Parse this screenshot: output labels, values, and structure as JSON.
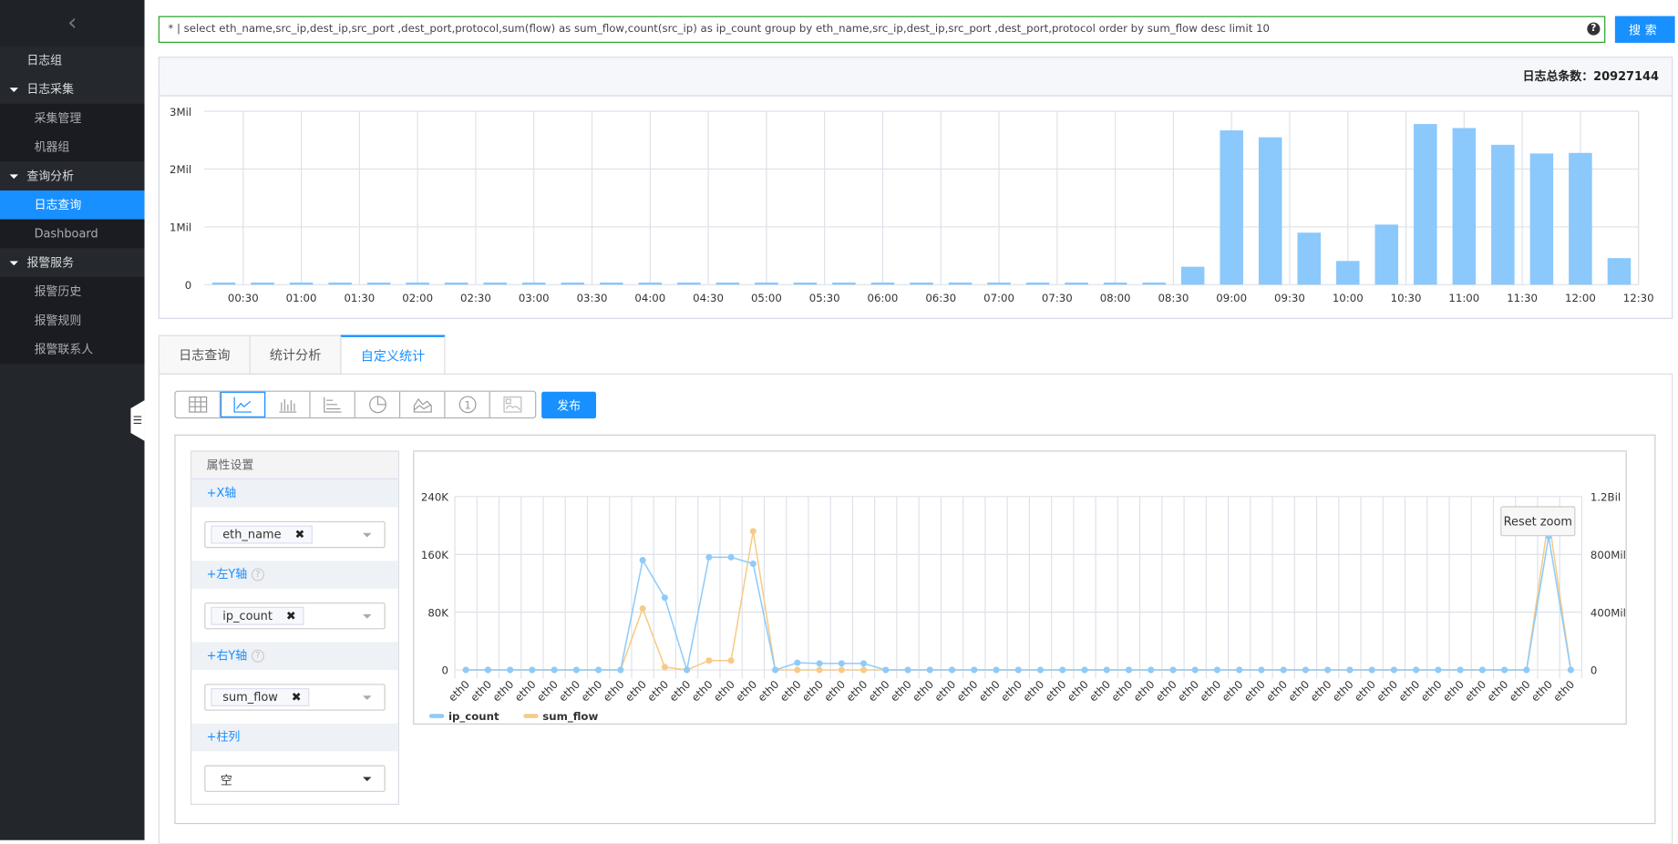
{
  "sidebar": {
    "collapse_icon": "chevron-left-icon",
    "items": [
      {
        "label": "日志组",
        "type": "item"
      },
      {
        "label": "日志采集",
        "type": "group"
      },
      {
        "label": "采集管理",
        "type": "sub"
      },
      {
        "label": "机器组",
        "type": "sub"
      },
      {
        "label": "查询分析",
        "type": "group"
      },
      {
        "label": "日志查询",
        "type": "sub",
        "active": true
      },
      {
        "label": "Dashboard",
        "type": "sub"
      },
      {
        "label": "报警服务",
        "type": "group"
      },
      {
        "label": "报警历史",
        "type": "sub"
      },
      {
        "label": "报警规则",
        "type": "sub"
      },
      {
        "label": "报警联系人",
        "type": "sub"
      }
    ]
  },
  "search": {
    "query": "* | select eth_name,src_ip,dest_ip,src_port ,dest_port,protocol,sum(flow) as sum_flow,count(src_ip) as ip_count group by eth_name,src_ip,dest_ip,src_port ,dest_port,protocol order by sum_flow desc limit 10",
    "help": "?",
    "button": "搜索"
  },
  "histogram": {
    "total_label": "日志总条数：",
    "total_value": "20927144"
  },
  "tabs": [
    {
      "label": "日志查询"
    },
    {
      "label": "统计分析"
    },
    {
      "label": "自定义统计",
      "active": true
    }
  ],
  "toolbar": {
    "icons": [
      "table-icon",
      "line-chart-icon",
      "bar-chart-icon",
      "column-chart-icon",
      "pie-chart-icon",
      "area-chart-icon",
      "number-icon",
      "map-icon"
    ],
    "active": "line-chart-icon",
    "publish": "发布"
  },
  "props": {
    "title": "属性设置",
    "x_axis": {
      "label": "+X轴",
      "value": "eth_name"
    },
    "left_y": {
      "label": "+左Y轴",
      "value": "ip_count"
    },
    "right_y": {
      "label": "+右Y轴",
      "value": "sum_flow"
    },
    "column": {
      "label": "+柱列",
      "value": "空"
    }
  },
  "reset_zoom": "Reset zoom",
  "colors": {
    "accent": "#1890ff",
    "bar": "#8bc8fc",
    "ip_count": "#8ecbfa",
    "sum_flow": "#f6cb87",
    "search_border": "#22a022"
  },
  "chart_data": [
    {
      "type": "bar",
      "xlim": [
        "00:10",
        "12:30"
      ],
      "x_ticks": [
        "00:30",
        "01:00",
        "01:30",
        "02:00",
        "02:30",
        "03:00",
        "03:30",
        "04:00",
        "04:30",
        "05:00",
        "05:30",
        "06:00",
        "06:30",
        "07:00",
        "07:30",
        "08:00",
        "08:30",
        "09:00",
        "09:30",
        "10:00",
        "10:30",
        "11:00",
        "11:30",
        "12:00",
        "12:30"
      ],
      "y_ticks": [
        "0",
        "1Mil",
        "2Mil",
        "3Mil"
      ],
      "ylim": [
        0,
        3000000
      ],
      "grid": true,
      "x": [
        "00:20",
        "00:40",
        "01:00",
        "01:20",
        "01:40",
        "02:00",
        "02:20",
        "02:40",
        "03:00",
        "03:20",
        "03:40",
        "04:00",
        "04:20",
        "04:40",
        "05:00",
        "05:20",
        "05:40",
        "06:00",
        "06:20",
        "06:40",
        "07:00",
        "07:20",
        "07:40",
        "08:00",
        "08:20",
        "08:40",
        "09:00",
        "09:20",
        "09:40",
        "10:00",
        "10:20",
        "10:40",
        "11:00",
        "11:20",
        "11:40",
        "12:00",
        "12:20"
      ],
      "values": [
        10000,
        10000,
        10000,
        10000,
        10000,
        10000,
        10000,
        10000,
        10000,
        10000,
        10000,
        10000,
        10000,
        10000,
        10000,
        10000,
        10000,
        10000,
        10000,
        10000,
        10000,
        10000,
        10000,
        10000,
        10000,
        310000,
        2670000,
        2550000,
        900000,
        410000,
        1040000,
        2780000,
        2710000,
        2420000,
        2270000,
        2280000,
        460000
      ]
    },
    {
      "type": "line",
      "category_label": "eth0",
      "category_count": 51,
      "left_y_ticks": [
        "0",
        "80K",
        "160K",
        "240K"
      ],
      "left_ylim": [
        0,
        240000
      ],
      "right_y_ticks": [
        "0",
        "400Mil",
        "800Mil",
        "1.2Bil"
      ],
      "right_ylim": [
        0,
        1200000000
      ],
      "grid": true,
      "legend": "bottom-left",
      "series": [
        {
          "name": "ip_count",
          "axis": "left",
          "values": [
            0,
            0,
            0,
            0,
            0,
            0,
            0,
            0,
            152000,
            100000,
            0,
            156000,
            156000,
            147000,
            0,
            10000,
            9000,
            9000,
            9000,
            0,
            0,
            0,
            0,
            0,
            0,
            0,
            0,
            0,
            0,
            0,
            0,
            0,
            0,
            0,
            0,
            0,
            0,
            0,
            0,
            0,
            0,
            0,
            0,
            0,
            0,
            0,
            0,
            0,
            0,
            185000,
            0
          ]
        },
        {
          "name": "sum_flow",
          "axis": "right",
          "values": [
            0,
            0,
            0,
            0,
            0,
            0,
            0,
            0,
            425000000,
            20000000,
            0,
            65000000,
            65000000,
            960000000,
            0,
            0,
            0,
            0,
            0,
            0,
            0,
            0,
            0,
            0,
            0,
            0,
            0,
            0,
            0,
            0,
            0,
            0,
            0,
            0,
            0,
            0,
            0,
            0,
            0,
            0,
            0,
            0,
            0,
            0,
            0,
            0,
            0,
            0,
            0,
            1050000000,
            0
          ]
        }
      ]
    }
  ]
}
